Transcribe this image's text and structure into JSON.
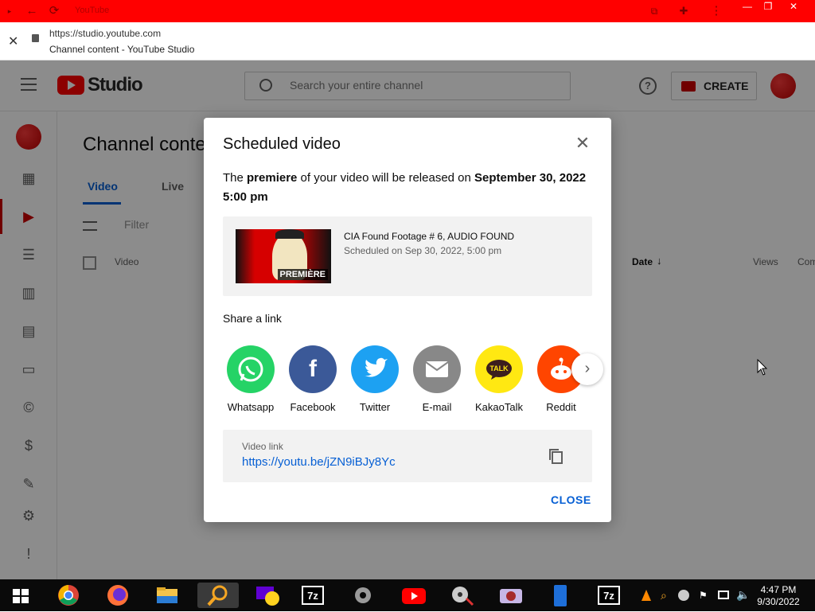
{
  "browser": {
    "tab_title": "YouTube",
    "url": "https://studio.youtube.com",
    "page_title": "Channel content - YouTube Studio",
    "minimize": "—",
    "restore": "❐",
    "close": "✕"
  },
  "studio": {
    "logo_text": "Studio",
    "search_placeholder": "Search your entire channel",
    "create_label": "CREATE",
    "page_title": "Channel conte",
    "tabs": [
      "Video",
      "Live"
    ],
    "filter_placeholder": "Filter",
    "columns": {
      "video": "Video",
      "date": "Date",
      "views": "Views",
      "comments": "Com"
    }
  },
  "modal": {
    "title": "Scheduled video",
    "desc_prefix": "The ",
    "desc_bold_1": "premiere",
    "desc_mid": " of your video will be released on ",
    "desc_bold_2": "September 30, 2022 5:00 pm",
    "video_title": "CIA Found Footage # 6, AUDIO FOUND",
    "video_scheduled": "Scheduled on Sep 30, 2022, 5:00 pm",
    "thumb_badge": "PREMIÈRE",
    "share_label": "Share a link",
    "share_items": [
      {
        "name": "Whatsapp",
        "icon": "whatsapp-icon",
        "color": "#25d366"
      },
      {
        "name": "Facebook",
        "icon": "facebook-icon",
        "color": "#3b5998"
      },
      {
        "name": "Twitter",
        "icon": "twitter-icon",
        "color": "#1da1f2"
      },
      {
        "name": "E-mail",
        "icon": "email-icon",
        "color": "#888888"
      },
      {
        "name": "KakaoTalk",
        "icon": "kakaotalk-icon",
        "color": "#ffe812"
      },
      {
        "name": "Reddit",
        "icon": "reddit-icon",
        "color": "#ff4500"
      }
    ],
    "link_label": "Video link",
    "link_url": "https://youtu.be/jZN9iBJy8Yc",
    "close_label": "CLOSE"
  },
  "taskbar": {
    "time": "4:47 PM",
    "date": "9/30/2022"
  }
}
